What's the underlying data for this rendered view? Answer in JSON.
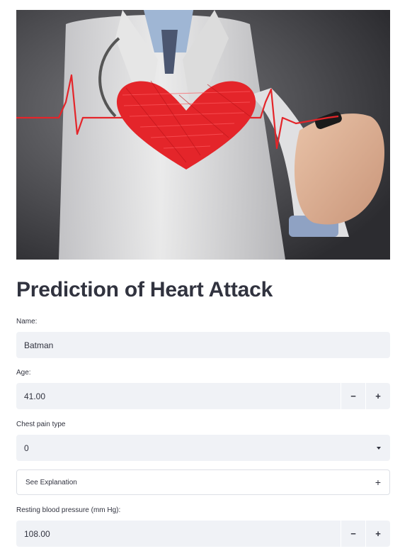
{
  "hero": {
    "icon": "heart-ecg-doctor-image",
    "accent_color": "#e4252a"
  },
  "page": {
    "title": "Prediction of Heart Attack"
  },
  "form": {
    "name": {
      "label": "Name:",
      "value": "Batman"
    },
    "age": {
      "label": "Age:",
      "value": "41.00",
      "decrement": "−",
      "increment": "+"
    },
    "chest_pain": {
      "label": "Chest pain type",
      "selected": "0"
    },
    "explanation": {
      "label": "See Explanation",
      "toggle": "+"
    },
    "resting_bp": {
      "label": "Resting blood pressure (mm Hg):",
      "value": "108.00",
      "decrement": "−",
      "increment": "+"
    }
  },
  "colors": {
    "input_bg": "#f0f2f6",
    "text": "#31333f",
    "border": "#dcdfe5"
  }
}
